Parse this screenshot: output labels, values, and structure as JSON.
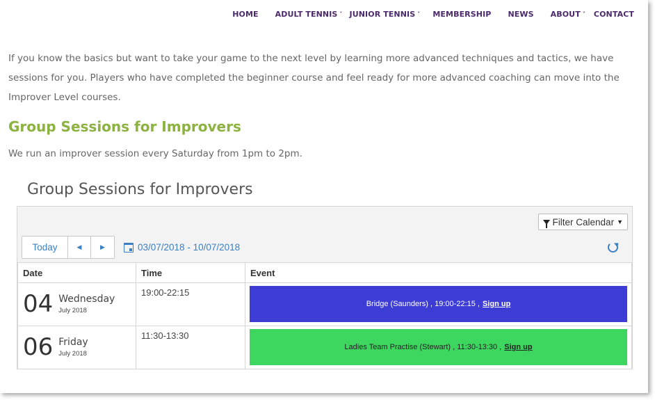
{
  "nav": {
    "items": [
      {
        "label": "HOME",
        "dropdown": false
      },
      {
        "label": "ADULT TENNIS",
        "dropdown": true
      },
      {
        "label": "JUNIOR TENNIS",
        "dropdown": true
      },
      {
        "label": "MEMBERSHIP",
        "dropdown": false
      },
      {
        "label": "NEWS",
        "dropdown": false
      },
      {
        "label": "ABOUT",
        "dropdown": true
      },
      {
        "label": "CONTACT",
        "dropdown": false
      }
    ]
  },
  "content": {
    "intro": "If you know the basics but want to take your game to the next level by learning more advanced techniques and tactics, we have sessions for you.  Players who have completed the beginner course and feel ready for more advanced coaching can move into the Improver Level courses.",
    "heading": "Group Sessions for Improvers",
    "description": "We run an improver session every Saturday from 1pm to 2pm."
  },
  "calendar": {
    "title": "Group Sessions for Improvers",
    "filter_label": "Filter Calendar",
    "today_label": "Today",
    "prev_icon": "◀",
    "next_icon": "▶",
    "date_range": "03/07/2018 - 10/07/2018",
    "columns": [
      "Date",
      "Time",
      "Event"
    ],
    "rows": [
      {
        "day_num": "04",
        "day_name": "Wednesday",
        "month": "July 2018",
        "time": "19:00-22:15",
        "event_text": "Bridge (Saunders) ,  19:00-22:15 ,",
        "signup": "Sign up",
        "color": "#3d3dd6"
      },
      {
        "day_num": "06",
        "day_name": "Friday",
        "month": "July 2018",
        "time": "11:30-13:30",
        "event_text": "Ladies Team Practise (Stewart) ,  11:30-13:30 ,",
        "signup": "Sign up",
        "color": "#3dd65f"
      }
    ]
  },
  "colors": {
    "nav_text": "#4b2a6b",
    "heading": "#8cb23f",
    "link": "#3a7fc4"
  }
}
